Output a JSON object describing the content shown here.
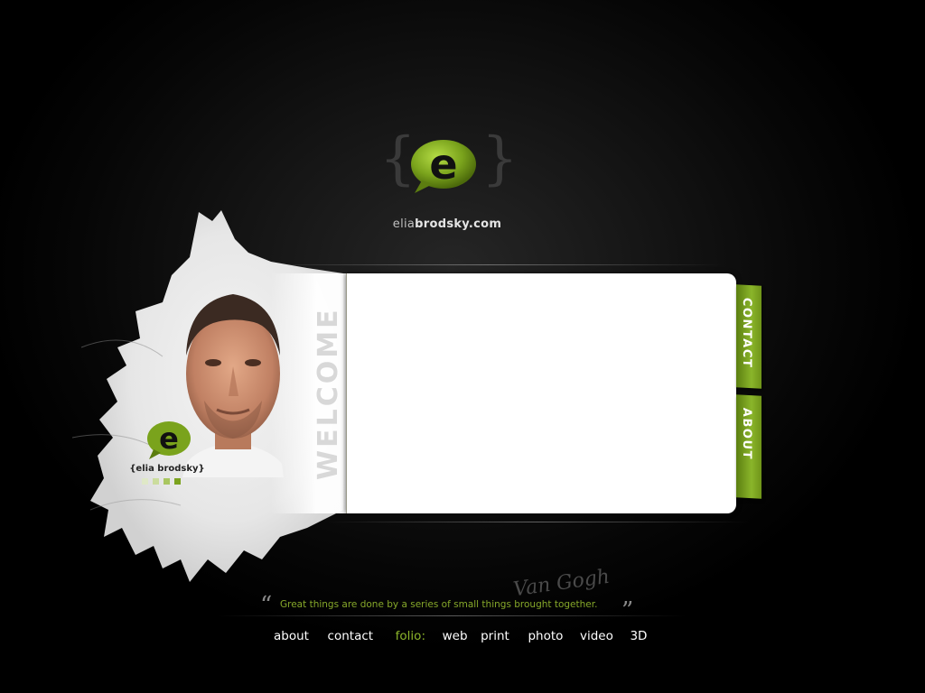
{
  "logo": {
    "letter": "e",
    "brace_open": "{",
    "brace_close": "}"
  },
  "site": {
    "name_light": "elia",
    "name_bold": "brodsky.com"
  },
  "panel": {
    "welcome": "WELCOME"
  },
  "brand": {
    "mini_letter": "e",
    "name": "{elia brodsky}"
  },
  "tabs": {
    "contact": "CONTACT",
    "about": "ABOUT"
  },
  "quote": {
    "open": "“",
    "text": "Great things are done by a series of small things brought together.",
    "close": "”",
    "signature": "Van Gogh"
  },
  "nav": {
    "about": "about",
    "contact": "contact",
    "folio": "folio:",
    "web": "web",
    "print": "print",
    "photo": "photo",
    "video": "video",
    "threed": "3D"
  },
  "colors": {
    "accent": "#8cb52a",
    "accent_dark": "#5b7e10",
    "background": "#000000"
  }
}
